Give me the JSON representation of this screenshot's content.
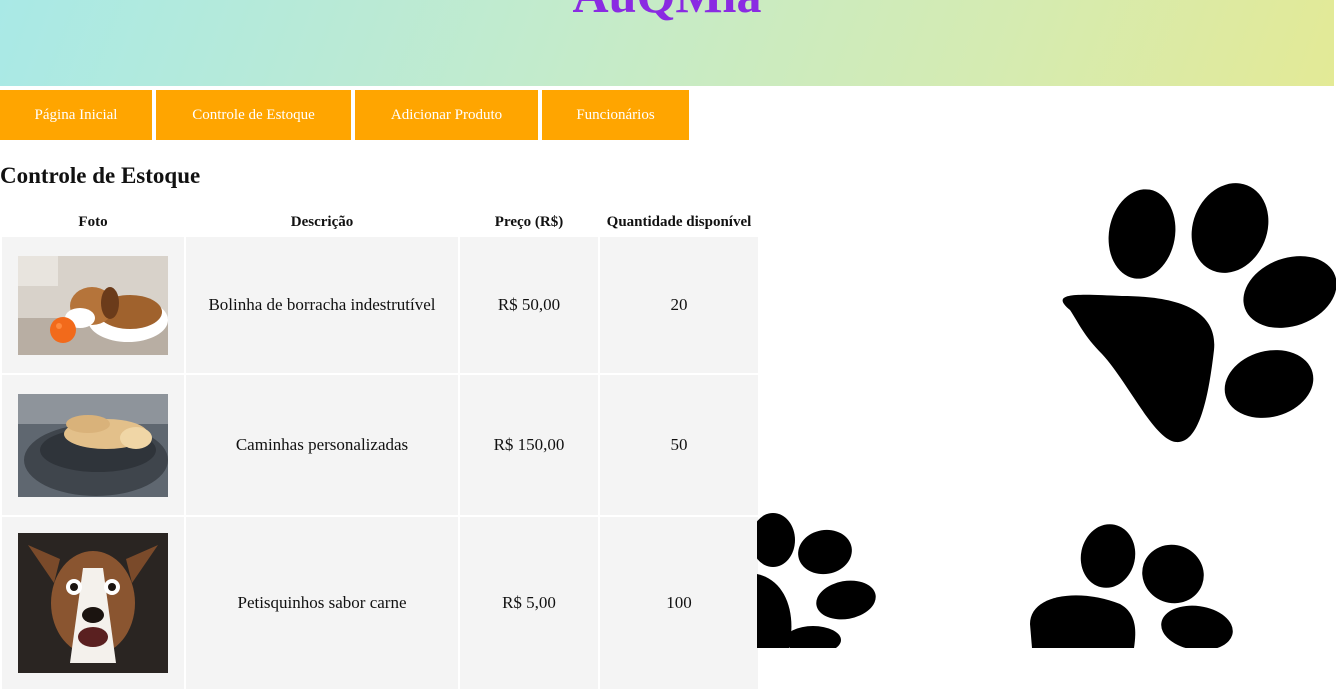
{
  "header": {
    "brand": "AuQMia"
  },
  "nav": [
    {
      "label": "Página Inicial"
    },
    {
      "label": "Controle de Estoque"
    },
    {
      "label": "Adicionar Produto"
    },
    {
      "label": "Funcionários"
    }
  ],
  "page_title": "Controle de Estoque",
  "table": {
    "headers": [
      "Foto",
      "Descrição",
      "Preço (R$)",
      "Quantidade disponível"
    ],
    "rows": [
      {
        "photo": "beagle-with-ball-photo",
        "description": "Bolinha de borracha indestrutível",
        "price": "R$ 50,00",
        "quantity": "20"
      },
      {
        "photo": "dog-sleeping-in-bed-photo",
        "description": "Caminhas personalizadas",
        "price": "R$ 150,00",
        "quantity": "50"
      },
      {
        "photo": "surprised-dog-photo",
        "description": "Petisquinhos sabor carne",
        "price": "R$ 5,00",
        "quantity": "100"
      }
    ]
  },
  "colors": {
    "nav": "#ffa500",
    "brand": "#8a2be2",
    "cell": "#f4f4f4"
  }
}
